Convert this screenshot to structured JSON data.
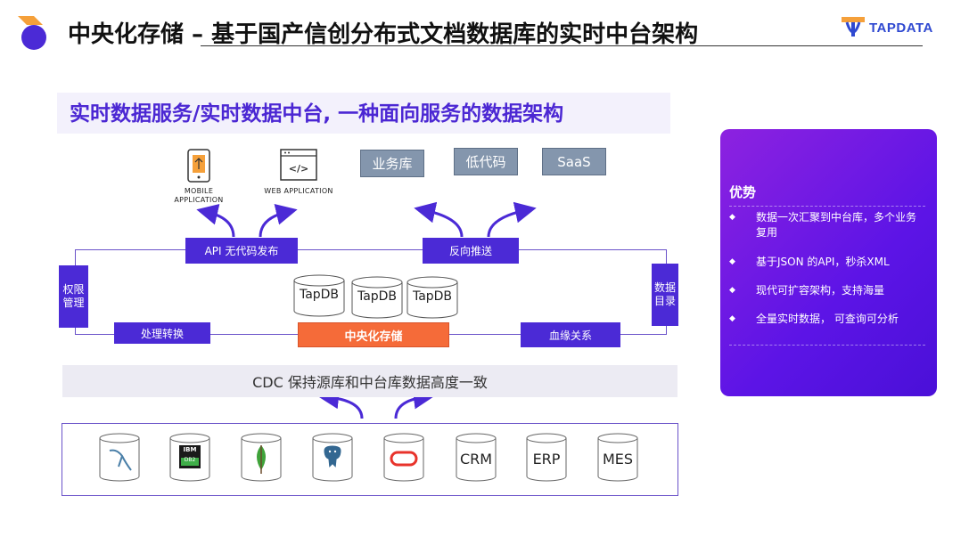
{
  "header": {
    "title": "中央化存储  – 基于国产信创分布式文档数据库的实时中台架构",
    "brand": "TAPDATA"
  },
  "subtitle": "实时数据服务/实时数据中台, 一种面向服务的数据架构",
  "apps": {
    "mobile": "MOBILE APPLICATION",
    "web": "WEB APPLICATION"
  },
  "targets": [
    "业务库",
    "低代码",
    "SaaS"
  ],
  "pills": {
    "api": "API 无代码发布",
    "push": "反向推送",
    "process": "处理转换",
    "central": "中央化存储",
    "lineage": "血缘关系",
    "permission": "权限管理",
    "catalog": "数据目录"
  },
  "tapdb": [
    "TapDB",
    "TapDB",
    "TapDB"
  ],
  "cdc": "CDC 保持源库和中台库数据高度一致",
  "sources": {
    "db2_top": "IBM",
    "db2_bottom": "DB2",
    "crm": "CRM",
    "erp": "ERP",
    "mes": "MES"
  },
  "advantages": {
    "title": "优势",
    "items": [
      "数据一次汇聚到中台库，多个业务复用",
      "基于JSON 的API，秒杀XML",
      "现代可扩容架构，支持海量",
      "全量实时数据， 可查询可分析"
    ]
  },
  "colors": {
    "accent": "#4b2ad6",
    "central": "#f56b39",
    "target_box": "#8496ad",
    "advantage_panel": "#6a18e3"
  }
}
